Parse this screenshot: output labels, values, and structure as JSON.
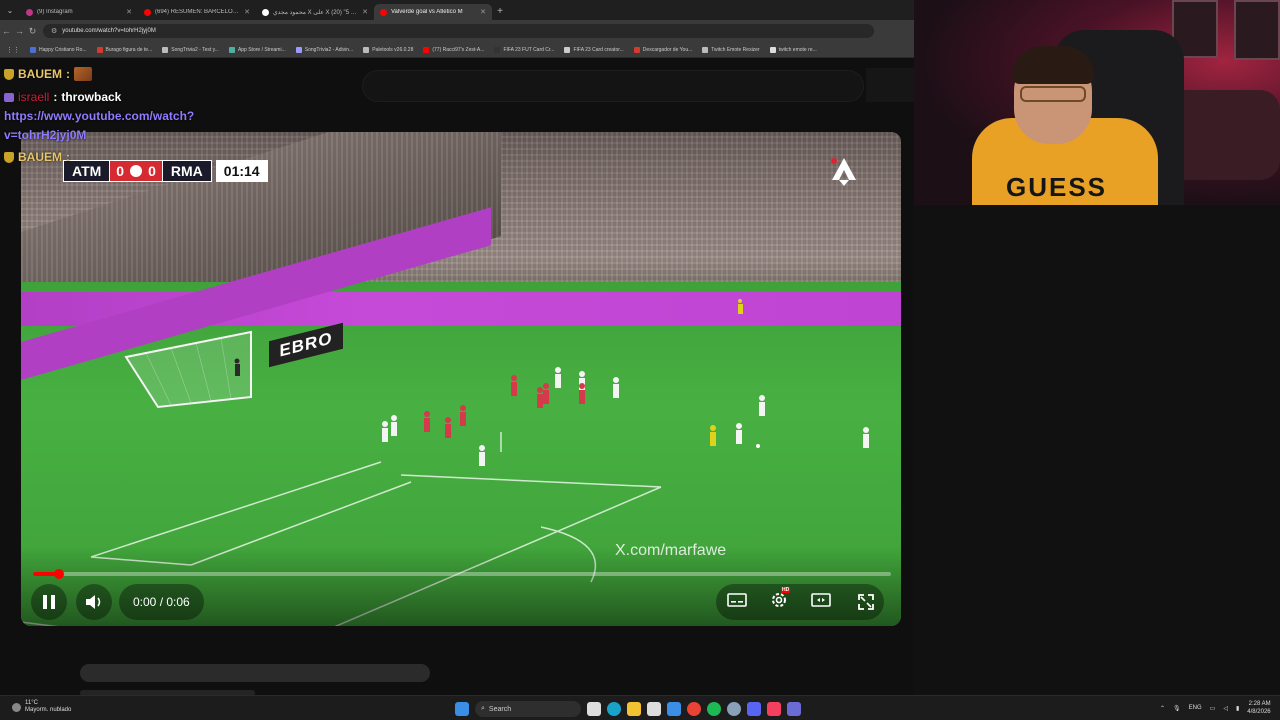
{
  "browser": {
    "tabs": [
      {
        "label": "(9) Instagram",
        "color": "#c13584",
        "active": false
      },
      {
        "label": "(694) RESUMEN: BARCELONA",
        "color": "#ff0000",
        "active": false
      },
      {
        "label": "محمود مجدي X على X تلاين 5\" (20)",
        "color": "#ffffff",
        "active": false
      },
      {
        "label": "Valverde goal vs Atletico M",
        "color": "#ff0000",
        "active": true
      }
    ],
    "new_tab": "+",
    "url": "youtube.com/watch?v=tohrH2jyj0M",
    "bookmarks": [
      {
        "label": "Happy Cristiano Ro...",
        "color": "#4a6fd6"
      },
      {
        "label": "Burago figura de te...",
        "color": "#d23b2e"
      },
      {
        "label": "SongTrivia2 - Test y...",
        "color": "#bbbbbb"
      },
      {
        "label": "App Store / Streami...",
        "color": "#4fb0a1"
      },
      {
        "label": "SongTrivia2 - Adivin...",
        "color": "#9b9bff"
      },
      {
        "label": "Paletools v26.0.28",
        "color": "#bbbbbb"
      },
      {
        "label": "(77) Racci97's Zest-A...",
        "color": "#ff0000"
      },
      {
        "label": "FIFA 23 FUT Card Cr...",
        "color": "#333333"
      },
      {
        "label": "FIFA 23 Card creator...",
        "color": "#cccccc"
      },
      {
        "label": "Descargador de You...",
        "color": "#d23b2e"
      },
      {
        "label": "Twitch Emote Resizer",
        "color": "#bbbbbb"
      },
      {
        "label": "twitch emote re...",
        "color": "#dddddd"
      }
    ]
  },
  "chat": [
    {
      "user": "BAUEM",
      "sep": ":",
      "message": "",
      "emote": true
    },
    {
      "user": "israell",
      "sep": ":",
      "message": "throwback",
      "emote": false
    },
    {
      "user": "BAUEM",
      "sep": ":",
      "message": "",
      "emote": false
    }
  ],
  "chat_link": {
    "line1": "https://www.youtube.com/watch?",
    "line2": "v=tohrH2jyj0M"
  },
  "video": {
    "scorebug": {
      "home": "ATM",
      "home_score": "0",
      "away_score": "0",
      "away": "RMA",
      "clock": "01:14"
    },
    "board_text": "EBRO",
    "watermark": "X.com/marfawe",
    "time": "0:00 / 0:06",
    "progress_fraction": 0.03,
    "hd_badge": "HD"
  },
  "webcam": {
    "shirt_text": "GUESS"
  },
  "taskbar": {
    "weather_temp": "11°C",
    "weather_desc": "Mayorm. nublado",
    "search_label": "Search",
    "lang": "ENG",
    "time": "2:28 AM",
    "date": "4/8/2026",
    "icons": [
      {
        "name": "windows-start",
        "color": "#3a8ee6"
      },
      {
        "name": "task-view",
        "color": "#dddddd"
      },
      {
        "name": "edge",
        "color": "#1aa3c9"
      },
      {
        "name": "file-explorer",
        "color": "#f2c233"
      },
      {
        "name": "store",
        "color": "#dddddd"
      },
      {
        "name": "mail",
        "color": "#3a8ee6"
      },
      {
        "name": "chrome",
        "color": "#ea4335"
      },
      {
        "name": "spotify",
        "color": "#1db954"
      },
      {
        "name": "steam",
        "color": "#8aa0b8"
      },
      {
        "name": "discord",
        "color": "#5865f2"
      },
      {
        "name": "music",
        "color": "#f43f5e"
      },
      {
        "name": "app",
        "color": "#6b6bd6"
      }
    ]
  }
}
